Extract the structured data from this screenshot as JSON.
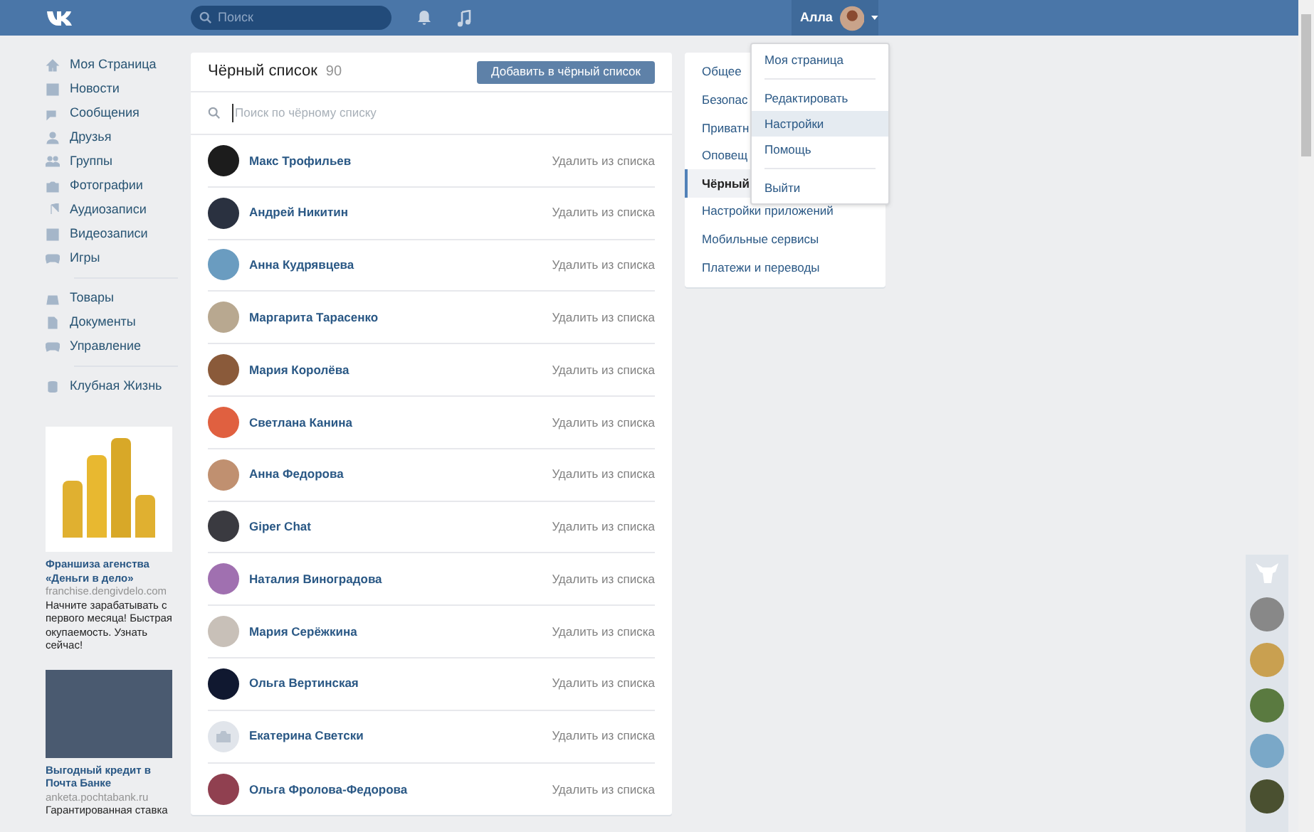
{
  "header": {
    "search": {
      "placeholder": "Поиск"
    },
    "user": {
      "name": "Алла"
    }
  },
  "nav": {
    "groups": [
      {
        "items": [
          "Моя Страница",
          "Новости",
          "Сообщения",
          "Друзья",
          "Группы",
          "Фотографии",
          "Аудиозаписи",
          "Видеозаписи",
          "Игры"
        ]
      },
      {
        "items": [
          "Товары",
          "Документы",
          "Управление"
        ]
      },
      {
        "items": [
          "Клубная Жизнь"
        ]
      }
    ]
  },
  "ads": [
    {
      "title": "Франшиза агенства «Деньги в дело»",
      "url": "franchise.dengivdelo.com",
      "text": "Начните зарабатывать с первого месяца! Быстрая окупаемость. Узнать сейчас!"
    },
    {
      "title": "Выгодный кредит в Почта Банке",
      "url": "anketa.pochtabank.ru",
      "text": "Гарантированная ставка"
    }
  ],
  "blacklist": {
    "title": "Чёрный список",
    "count": "90",
    "add_button": "Добавить в чёрный список",
    "search": {
      "placeholder": "Поиск по чёрному списку"
    },
    "rows": [
      {
        "name": "Макс Трофильев",
        "action": "Удалить из списка",
        "has_photo": true,
        "color": "#1c1c1c"
      },
      {
        "name": "Андрей Никитин",
        "action": "Удалить из списка",
        "has_photo": true,
        "color": "#2a3140"
      },
      {
        "name": "Анна Кудрявцева",
        "action": "Удалить из списка",
        "has_photo": true,
        "color": "#6a9cc0"
      },
      {
        "name": "Маргарита Тарасенко",
        "action": "Удалить из списка",
        "has_photo": true,
        "color": "#b8a890"
      },
      {
        "name": "Мария Королёва",
        "action": "Удалить из списка",
        "has_photo": true,
        "color": "#8a5a3a"
      },
      {
        "name": "Светлана Канина",
        "action": "Удалить из списка",
        "has_photo": true,
        "color": "#e06040"
      },
      {
        "name": "Анна Федорова",
        "action": "Удалить из списка",
        "has_photo": true,
        "color": "#c09070"
      },
      {
        "name": "Giper Chat",
        "action": "Удалить из списка",
        "has_photo": true,
        "color": "#3a3a40"
      },
      {
        "name": "Наталия Виноградова",
        "action": "Удалить из списка",
        "has_photo": true,
        "color": "#a070b0"
      },
      {
        "name": "Мария Серёжкина",
        "action": "Удалить из списка",
        "has_photo": true,
        "color": "#c8c0b8"
      },
      {
        "name": "Ольга Вертинская",
        "action": "Удалить из списка",
        "has_photo": true,
        "color": "#101830"
      },
      {
        "name": "Екатерина Светски",
        "action": "Удалить из списка",
        "has_photo": false,
        "color": "#e1e5eb"
      },
      {
        "name": "Ольга Фролова-Федорова",
        "action": "Удалить из списка",
        "has_photo": true,
        "color": "#904050"
      }
    ]
  },
  "settings_menu": {
    "items": [
      {
        "label": "Общее",
        "selected": false
      },
      {
        "label": "Безопас",
        "selected": false
      },
      {
        "label": "Приватн",
        "selected": false
      },
      {
        "label": "Оповещ",
        "selected": false
      },
      {
        "label": "Чёрный",
        "selected": true
      },
      {
        "label": "Настройки приложений",
        "selected": false
      },
      {
        "label": "Мобильные сервисы",
        "selected": false
      },
      {
        "label": "Платежи и переводы",
        "selected": false
      }
    ]
  },
  "profile_menu": {
    "groups": [
      {
        "items": [
          {
            "label": "Моя страница",
            "highlighted": false
          }
        ]
      },
      {
        "items": [
          {
            "label": "Редактировать",
            "highlighted": false
          },
          {
            "label": "Настройки",
            "highlighted": true
          },
          {
            "label": "Помощь",
            "highlighted": false
          }
        ]
      },
      {
        "items": [
          {
            "label": "Выйти",
            "highlighted": false
          }
        ]
      }
    ]
  }
}
